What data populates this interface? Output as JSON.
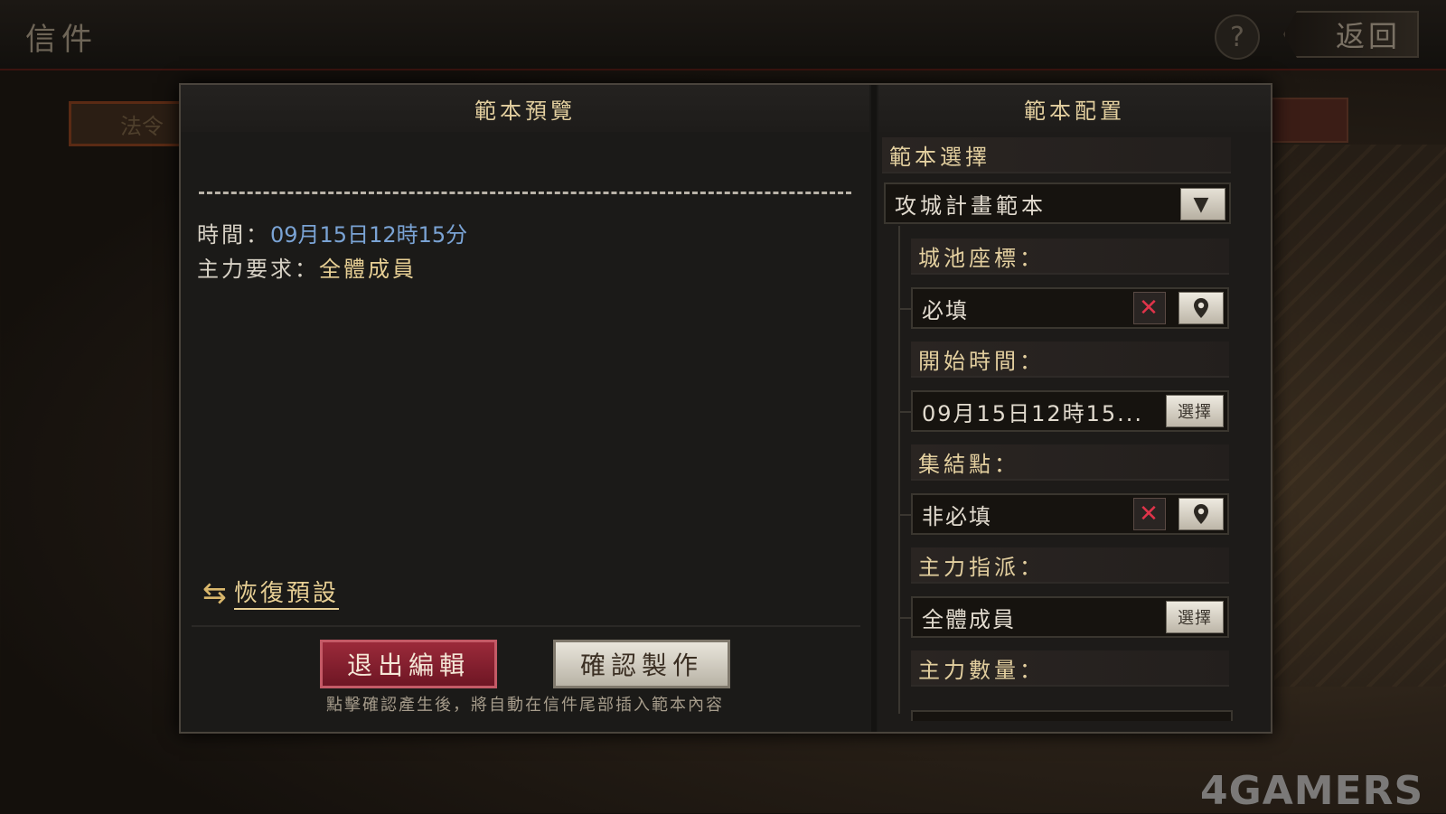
{
  "topbar": {
    "title": "信件",
    "help_icon": "?",
    "back_label": "返回"
  },
  "background": {
    "tab_label": "法令"
  },
  "watermark": "4GAMERS",
  "preview": {
    "header": "範本預覽",
    "time_label": "時間：",
    "time_value": "09月15日12時15分",
    "main_label": "主力要求：",
    "main_value": "全體成員",
    "restore_label": "恢復預設",
    "exit_button": "退出編輯",
    "confirm_button": "確認製作",
    "footer_note": "點擊確認產生後，將自動在信件尾部插入範本內容"
  },
  "config": {
    "header": "範本配置",
    "template_select_label": "範本選擇",
    "template_selected": "攻城計畫範本",
    "city_coord_label": "城池座標：",
    "city_coord_value": "必填",
    "start_time_label": "開始時間：",
    "start_time_value": "09月15日12時15...",
    "pick_button": "選擇",
    "rally_point_label": "集結點：",
    "rally_point_value": "非必填",
    "main_assign_label": "主力指派：",
    "main_assign_value": "全體成員",
    "main_count_label": "主力數量："
  },
  "colors": {
    "accent_gold": "#e3cf9f",
    "time_blue": "#7aa3d4",
    "exit_red": "#8a2232",
    "clear_red": "#e0344a"
  }
}
